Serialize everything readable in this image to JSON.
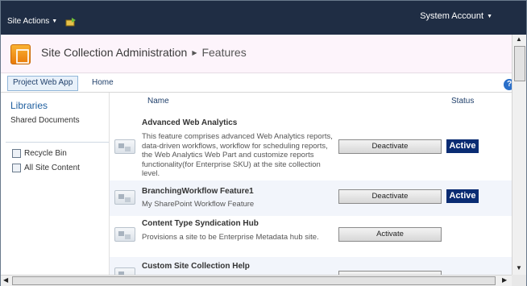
{
  "topbar": {
    "site_actions_label": "Site Actions",
    "account_label": "System Account"
  },
  "breadcrumb": {
    "root": "Site Collection Administration",
    "current": "Features"
  },
  "linkbar": {
    "tabs": [
      {
        "label": "Project Web App"
      },
      {
        "label": "Home"
      }
    ]
  },
  "leftnav": {
    "heading": "Libraries",
    "items": [
      "Shared Documents"
    ],
    "utility": [
      {
        "label": "Recycle Bin",
        "icon": "recycle-bin-icon"
      },
      {
        "label": "All Site Content",
        "icon": "site-content-icon"
      }
    ]
  },
  "table": {
    "headers": {
      "name": "Name",
      "status": "Status"
    },
    "features": [
      {
        "title": "Advanced Web Analytics",
        "description": "This feature comprises advanced Web Analytics reports, data-driven workflows, workflow for scheduling reports, the Web Analytics Web Part and customize reports functionality(for Enterprise SKU) at the site collection level.",
        "action": "Deactivate",
        "status": "Active"
      },
      {
        "title": "BranchingWorkflow Feature1",
        "description": "My SharePoint Workflow Feature",
        "action": "Deactivate",
        "status": "Active"
      },
      {
        "title": "Content Type Syndication Hub",
        "description": "Provisions a site to be Enterprise Metadata hub site.",
        "action": "Activate",
        "status": ""
      },
      {
        "title": "Custom Site Collection Help",
        "description": "",
        "action": "",
        "status": ""
      }
    ]
  },
  "colors": {
    "topbar": "#1f2d44",
    "title_bg": "#fdf4fb",
    "active_badge": "#0a2c73",
    "link": "#1f5f9f"
  }
}
